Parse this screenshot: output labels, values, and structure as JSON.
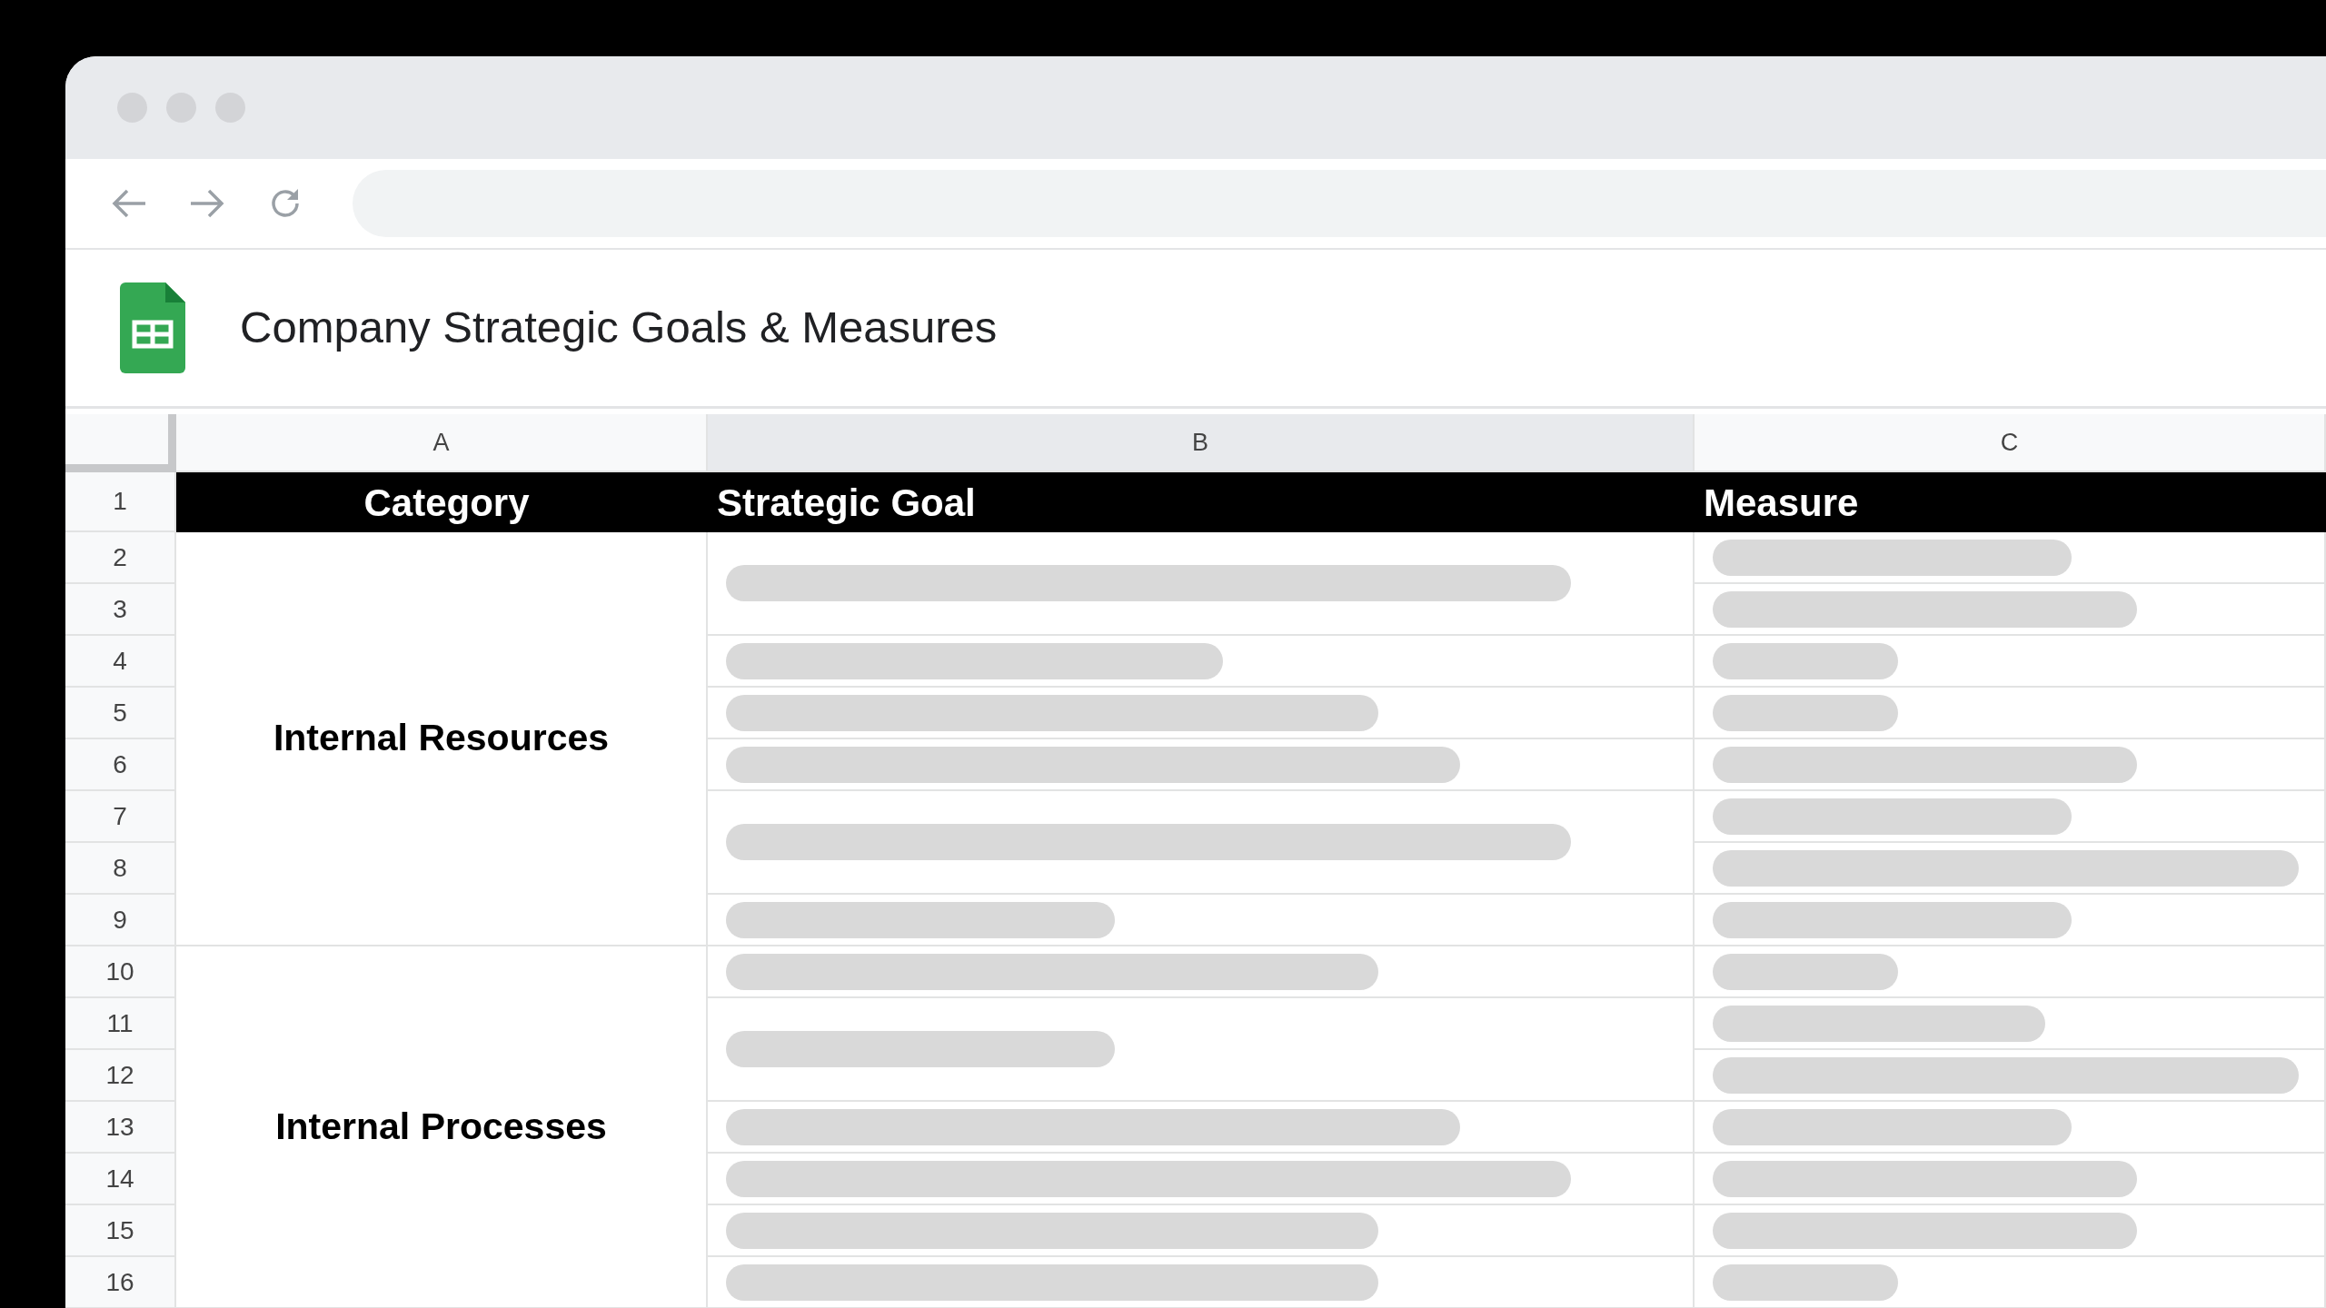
{
  "document": {
    "title": "Company Strategic Goals & Measures"
  },
  "columns": [
    {
      "letter": "A",
      "selected": false
    },
    {
      "letter": "B",
      "selected": true
    },
    {
      "letter": "C",
      "selected": false
    }
  ],
  "row_numbers": [
    "1",
    "2",
    "3",
    "4",
    "5",
    "6",
    "7",
    "8",
    "9",
    "10",
    "11",
    "12",
    "13",
    "14",
    "15",
    "16"
  ],
  "header_row": [
    "Category",
    "Strategic Goal",
    "Measure"
  ],
  "groups": [
    {
      "category": "Internal Resources",
      "goals": [
        {
          "kind": "placeholder",
          "measures": [
            {
              "kind": "placeholder"
            },
            {
              "kind": "placeholder"
            }
          ]
        },
        {
          "kind": "placeholder",
          "measures": [
            {
              "kind": "placeholder"
            }
          ]
        },
        {
          "kind": "placeholder",
          "measures": [
            {
              "kind": "placeholder"
            }
          ]
        },
        {
          "kind": "placeholder",
          "measures": [
            {
              "kind": "placeholder"
            }
          ]
        },
        {
          "kind": "placeholder",
          "measures": [
            {
              "kind": "placeholder"
            },
            {
              "kind": "placeholder"
            }
          ]
        },
        {
          "kind": "placeholder",
          "measures": [
            {
              "kind": "placeholder"
            }
          ]
        }
      ]
    },
    {
      "category": "Internal Processes",
      "goals": [
        {
          "kind": "placeholder",
          "measures": [
            {
              "kind": "placeholder"
            }
          ]
        },
        {
          "kind": "placeholder",
          "measures": [
            {
              "kind": "placeholder"
            },
            {
              "kind": "placeholder"
            }
          ]
        },
        {
          "kind": "placeholder",
          "measures": [
            {
              "kind": "placeholder"
            }
          ]
        },
        {
          "kind": "placeholder",
          "measures": [
            {
              "kind": "placeholder"
            }
          ]
        },
        {
          "kind": "placeholder",
          "measures": [
            {
              "kind": "placeholder"
            }
          ]
        },
        {
          "kind": "placeholder",
          "measures": [
            {
              "kind": "placeholder"
            }
          ]
        }
      ]
    }
  ]
}
